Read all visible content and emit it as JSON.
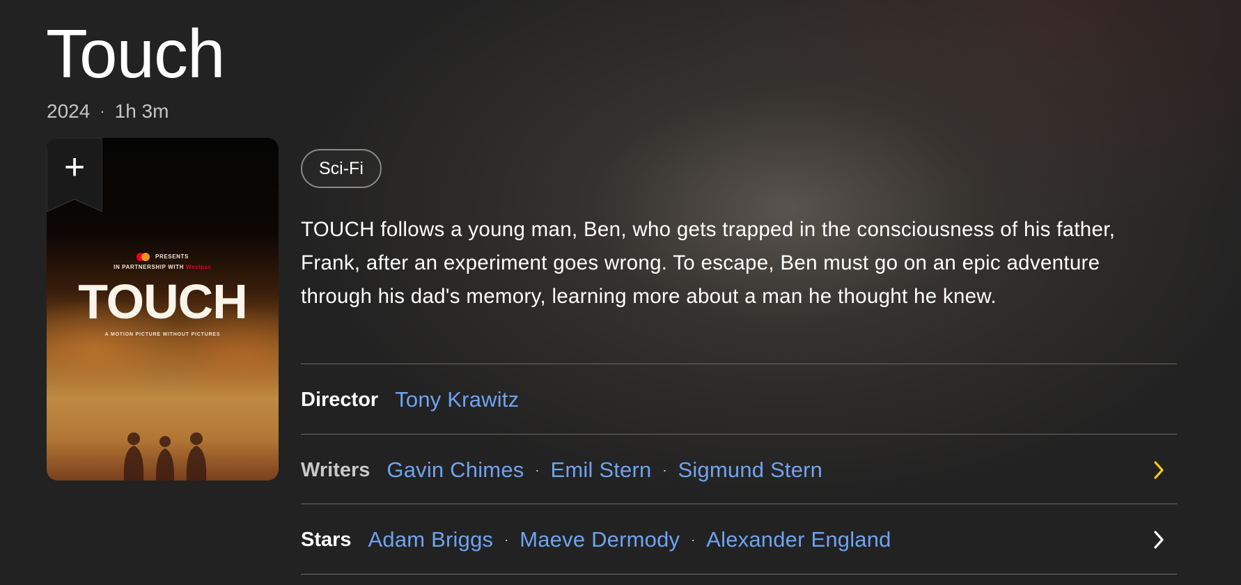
{
  "title": "Touch",
  "meta": {
    "year": "2024",
    "separator": "·",
    "runtime": "1h 3m"
  },
  "poster": {
    "add_icon": "plus-icon",
    "presents": "PRESENTS",
    "partnership": "IN PARTNERSHIP WITH",
    "partner_brand": "Westpac",
    "poster_title": "TOUCH",
    "tagline": "A MOTION PICTURE WITHOUT PICTURES"
  },
  "genre": "Sci-Fi",
  "plot": "TOUCH follows a young man, Ben, who gets trapped in the consciousness of his father, Frank, after an experiment goes wrong. To escape, Ben must go on an epic adventure through his dad's memory, learning more about a man he thought he knew.",
  "credits": {
    "director": {
      "label": "Director",
      "names": [
        "Tony Krawitz"
      ]
    },
    "writers": {
      "label": "Writers",
      "names": [
        "Gavin Chimes",
        "Emil Stern",
        "Sigmund Stern"
      ]
    },
    "stars": {
      "label": "Stars",
      "names": [
        "Adam Briggs",
        "Maeve Dermody",
        "Alexander England"
      ]
    }
  },
  "colors": {
    "link": "#6fa3f0",
    "writers_chevron": "#f5c518",
    "stars_chevron": "#ffffff",
    "background": "#222222"
  },
  "icons": {
    "chevron": "chevron-right-icon",
    "add": "plus-icon"
  }
}
